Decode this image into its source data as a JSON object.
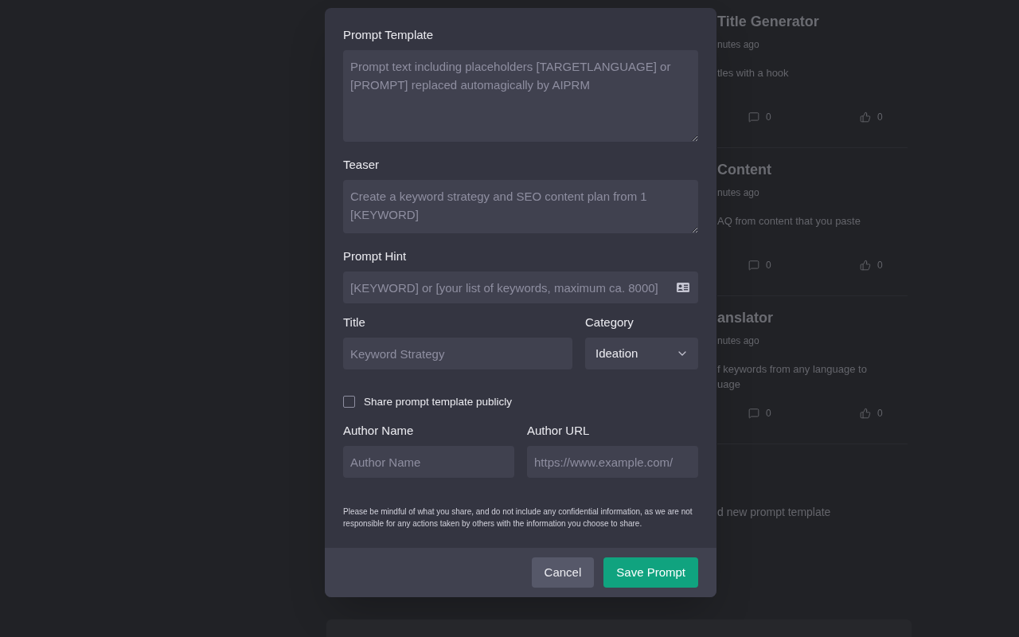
{
  "background": {
    "cards": [
      {
        "title": "Title Generator",
        "time": "nutes ago",
        "description": [
          "tles with a hook"
        ],
        "comments": "0",
        "likes": "0"
      },
      {
        "title": "Content",
        "time": "nutes ago",
        "description": [
          "AQ from content that you paste"
        ],
        "comments": "0",
        "likes": "0"
      },
      {
        "title": "anslator",
        "time": "nutes ago",
        "description": [
          "f keywords from any language to",
          "uage"
        ],
        "comments": "0",
        "likes": "0"
      }
    ],
    "add_prompt": "d new prompt template"
  },
  "dialog": {
    "prompt_template": {
      "label": "Prompt Template",
      "placeholder": "Prompt text including placeholders [TARGETLANGUAGE] or [PROMPT] replaced automagically by AIPRM"
    },
    "teaser": {
      "label": "Teaser",
      "placeholder": "Create a keyword strategy and SEO content plan from 1 [KEYWORD]"
    },
    "prompt_hint": {
      "label": "Prompt Hint",
      "placeholder": "[KEYWORD] or [your list of keywords, maximum ca. 8000]"
    },
    "title": {
      "label": "Title",
      "placeholder": "Keyword Strategy"
    },
    "category": {
      "label": "Category",
      "value": "Ideation"
    },
    "share": {
      "label": "Share prompt template publicly",
      "checked": false
    },
    "author_name": {
      "label": "Author Name",
      "placeholder": "Author Name"
    },
    "author_url": {
      "label": "Author URL",
      "placeholder": "https://www.example.com/"
    },
    "disclaimer": "Please be mindful of what you share, and do not include any confidential information, as we are not responsible for any actions taken by others with the information you choose to share.",
    "buttons": [
      {
        "label": "Cancel",
        "kind": "secondary"
      },
      {
        "label": "Save Prompt",
        "kind": "primary"
      }
    ]
  }
}
